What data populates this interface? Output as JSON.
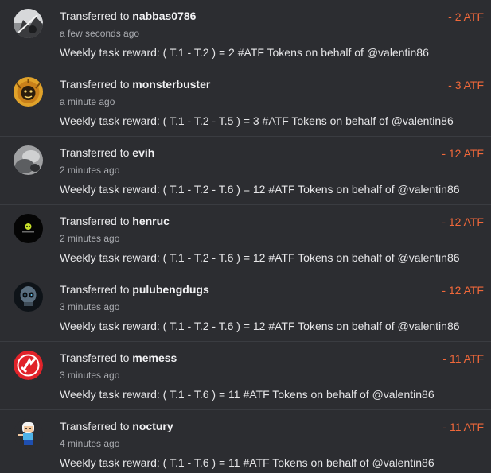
{
  "transfers": [
    {
      "prefix": "Transferred to ",
      "user": "nabbas0786",
      "time": "a few seconds ago",
      "memo": "Weekly task reward: ( T.1 - T.2 ) = 2 #ATF Tokens on behalf of @valentin86",
      "amount": "- 2 ATF",
      "avatar_icon": "grayscale-photo-avatar-icon"
    },
    {
      "prefix": "Transferred to ",
      "user": "monsterbuster",
      "time": "a minute ago",
      "memo": "Weekly task reward: ( T.1 - T.2 - T.5 ) = 3 #ATF Tokens on behalf of @valentin86",
      "amount": "- 3 ATF",
      "avatar_icon": "golden-lion-avatar-icon"
    },
    {
      "prefix": "Transferred to ",
      "user": "evih",
      "time": "2 minutes ago",
      "memo": "Weekly task reward: ( T.1 - T.2 - T.6 ) = 12 #ATF Tokens on behalf of @valentin86",
      "amount": "- 12 ATF",
      "avatar_icon": "gray-photo-avatar-icon"
    },
    {
      "prefix": "Transferred to ",
      "user": "henruc",
      "time": "2 minutes ago",
      "memo": "Weekly task reward: ( T.1 - T.2 - T.6 ) = 12 #ATF Tokens on behalf of @valentin86",
      "amount": "- 12 ATF",
      "avatar_icon": "black-logo-avatar-icon"
    },
    {
      "prefix": "Transferred to ",
      "user": "pulubengdugs",
      "time": "3 minutes ago",
      "memo": "Weekly task reward: ( T.1 - T.2 - T.6 ) = 12 #ATF Tokens on behalf of @valentin86",
      "amount": "- 12 ATF",
      "avatar_icon": "skull-avatar-icon"
    },
    {
      "prefix": "Transferred to ",
      "user": "memess",
      "time": "3 minutes ago",
      "memo": "Weekly task reward: ( T.1 - T.6 ) = 11 #ATF Tokens on behalf of @valentin86",
      "amount": "- 11 ATF",
      "avatar_icon": "red-arrows-avatar-icon"
    },
    {
      "prefix": "Transferred to ",
      "user": "noctury",
      "time": "4 minutes ago",
      "memo": "Weekly task reward: ( T.1 - T.6 ) = 11 #ATF Tokens on behalf of @valentin86",
      "amount": "- 11 ATF",
      "avatar_icon": "cartoon-character-avatar-icon"
    }
  ],
  "colors": {
    "background": "#2c2d31",
    "amount": "#f0683a",
    "divider": "#3a3c41"
  }
}
